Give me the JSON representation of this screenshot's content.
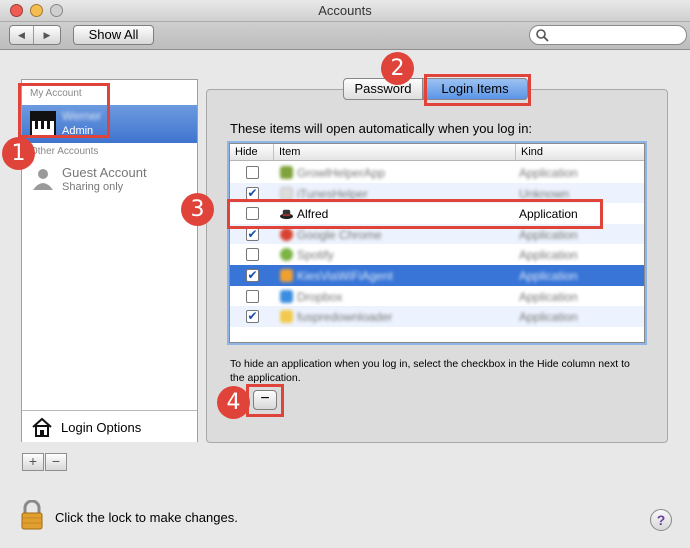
{
  "window": {
    "title": "Accounts"
  },
  "toolbar": {
    "back_icon": "back-arrow-icon",
    "forward_icon": "forward-arrow-icon",
    "show_all_label": "Show All",
    "search_value": "",
    "search_placeholder": ""
  },
  "sidebar": {
    "my_account_label": "My Account",
    "current_user": {
      "name": "Werner",
      "role": "Admin"
    },
    "other_accounts_label": "Other Accounts",
    "guest": {
      "name": "Guest Account",
      "role": "Sharing only"
    },
    "login_options_label": "Login Options",
    "add_label": "+",
    "remove_label": "−"
  },
  "tabs": [
    {
      "label": "Password",
      "selected": false
    },
    {
      "label": "Login Items",
      "selected": true
    }
  ],
  "login_items": {
    "intro": "These items will open automatically when you log in:",
    "columns": {
      "hide": "Hide",
      "item": "Item",
      "kind": "Kind"
    },
    "rows": [
      {
        "name": "GrowlHelperApp",
        "kind": "Application",
        "checked": false,
        "icon_color": "#7fa23a"
      },
      {
        "name": "iTunesHelper",
        "kind": "Unknown",
        "checked": true,
        "icon_color": "#dddddd"
      },
      {
        "name": "Alfred",
        "kind": "Application",
        "checked": false,
        "icon_color": "#333333"
      },
      {
        "name": "Google Chrome",
        "kind": "Application",
        "checked": true,
        "icon_color": "#d9412f"
      },
      {
        "name": "Spotify",
        "kind": "Application",
        "checked": false,
        "icon_color": "#7cb342"
      },
      {
        "name": "KiesViaWiFiAgent",
        "kind": "Application",
        "checked": true,
        "icon_color": "#f0a030"
      },
      {
        "name": "Dropbox",
        "kind": "Application",
        "checked": false,
        "icon_color": "#3b8de0"
      },
      {
        "name": "fuspredownloader",
        "kind": "Application",
        "checked": true,
        "icon_color": "#f2c94c"
      }
    ],
    "hint": "To hide an application when you log in, select the checkbox in the Hide column next to the application.",
    "remove_label": "−"
  },
  "footer": {
    "lock_text": "Click the lock to make changes.",
    "help_label": "?"
  },
  "callouts": [
    "1",
    "2",
    "3",
    "4"
  ],
  "colors": {
    "selection": "#3875d7",
    "callout": "#e0433a"
  }
}
